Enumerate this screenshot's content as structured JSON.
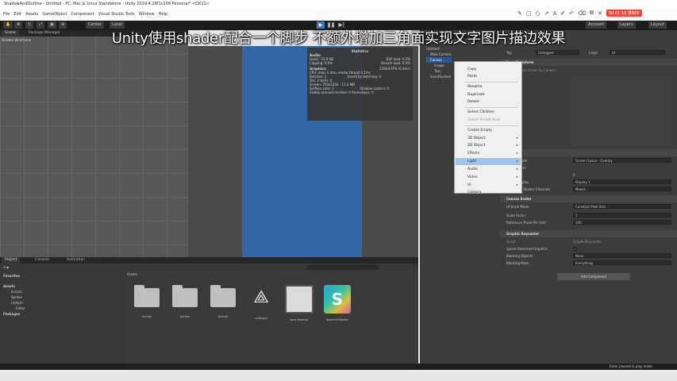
{
  "window": {
    "title": "ShadowAndOutline - Untitled - PC, Mac & Linux Standalone - Unity 2019.4.29f1c109 Personal* <DX11>"
  },
  "menu": [
    "File",
    "Edit",
    "Assets",
    "GameObject",
    "Component",
    "Visual Studio Tools",
    "Window",
    "Help"
  ],
  "annotation": {
    "record_label": "00:01:15 录制中"
  },
  "toolbar": {
    "center": "Center",
    "local": "Local",
    "account": "Account",
    "layers": "Layers",
    "layout": "Layout"
  },
  "subtitle": "Unity使用shader配合一个脚步 不额外增加三角面实现文字图片描边效果",
  "scene": {
    "tabs": [
      "Scene",
      "Package Manager"
    ],
    "mode": "Shaded Wireframe"
  },
  "stats": {
    "title": "Statistics",
    "audio_head": "Audio:",
    "level": "Level: -74.8 dB",
    "dsp": "DSP load: 0.2%",
    "clipping": "Clipping: 0.0%",
    "stream": "Stream load: 0.0%",
    "graphics_head": "Graphics:",
    "fps": "2358.8 FPS (0.4ms)",
    "cpu": "CPU: main 0.4ms  render thread 0.1ms",
    "batches": "Batches: 2",
    "saved": "Saved by batching: 0",
    "tris": "Tris: 2  Verts: 0",
    "screen": "Screen: 750x1334 - 11.4 MB",
    "setpass": "SetPass calls: 2",
    "shadow": "Shadow casters: 0",
    "skinned": "Visible skinned meshes: 0  Animations: 0"
  },
  "hierarchy": {
    "items": [
      "Untitled*",
      "Main Camera",
      "Canvas",
      "Image",
      "Text",
      "EventSystem"
    ]
  },
  "context_menu": {
    "items": [
      "Copy",
      "Paste",
      "Rename",
      "Duplicate",
      "Delete",
      "Select Children",
      "Select Prefab Root",
      "Create Empty",
      "3D Object",
      "2D Object",
      "Effects",
      "Light",
      "Audio",
      "Video",
      "UI",
      "Camera"
    ],
    "highlighted": "Light"
  },
  "inspector": {
    "tag_label": "Tag",
    "tag_value": "Untagged",
    "layer_label": "Layer",
    "layer_value": "UI",
    "rect_transform": "Rect Transform",
    "some_values": "Some values driven by Canvas.",
    "canvas": "Canvas",
    "render_mode_label": "Render Mode",
    "render_mode_value": "Screen Space - Overlay",
    "pixel_perfect": "Pixel Perfect",
    "sort_order": "Sort Order",
    "sort_value": "0",
    "target_display": "Target Display",
    "target_value": "Display 1",
    "additional": "Additional Shader Channels",
    "additional_value": "Mixed...",
    "canvas_scaler": "Canvas Scaler",
    "ui_scale_label": "UI Scale Mode",
    "ui_scale_value": "Constant Pixel Size",
    "scale_factor_label": "Scale Factor",
    "scale_factor_value": "1",
    "ref_ppu_label": "Reference Pixels Per Unit",
    "ref_ppu_value": "100",
    "raycaster": "Graphic Raycaster",
    "script_label": "Script",
    "script_value": "GraphicRaycaster",
    "ignore_label": "Ignore Reversed Graphics",
    "blocking_objects_label": "Blocking Objects",
    "blocking_objects_value": "None",
    "blocking_mask_label": "Blocking Mask",
    "blocking_mask_value": "Everything",
    "add_component": "Add Component"
  },
  "project": {
    "tabs": [
      "Project",
      "Console",
      "Animation"
    ],
    "tree": [
      "Favorites",
      "Assets",
      "Scripts",
      "Sprites",
      "UnityUI",
      "Editor",
      "Packages"
    ],
    "assets_header": "Assets",
    "assets": [
      "Scripts",
      "Sprites",
      "UnityUI",
      "unityapp",
      "New Material",
      "NewUnlitShader"
    ]
  },
  "status": {
    "right": "Enter paused in play mode"
  }
}
